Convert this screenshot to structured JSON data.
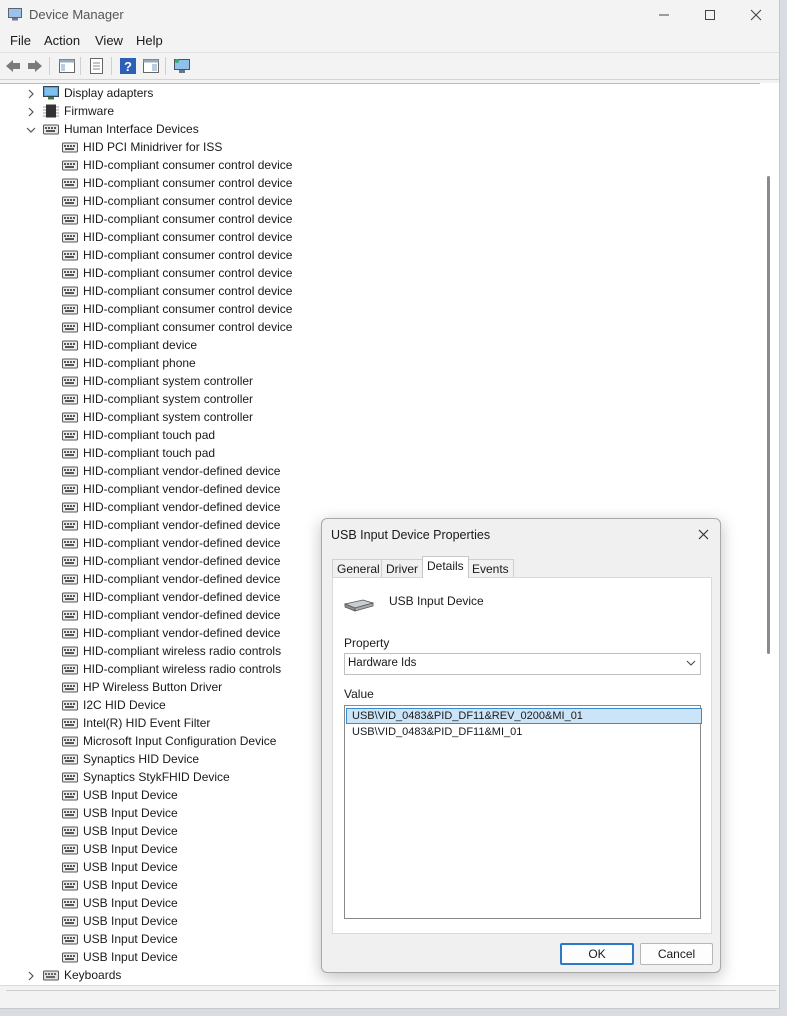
{
  "window": {
    "title": "Device Manager"
  },
  "menu": [
    "File",
    "Action",
    "View",
    "Help"
  ],
  "tree": {
    "categories_top": [
      {
        "label": "Display adapters",
        "expanded": false,
        "icon": "display-adapter-icon"
      },
      {
        "label": "Firmware",
        "expanded": false,
        "icon": "firmware-chip-icon"
      },
      {
        "label": "Human Interface Devices",
        "expanded": true,
        "icon": "hid-icon"
      }
    ],
    "hid_children": [
      "HID PCI Minidriver for ISS",
      "HID-compliant consumer control device",
      "HID-compliant consumer control device",
      "HID-compliant consumer control device",
      "HID-compliant consumer control device",
      "HID-compliant consumer control device",
      "HID-compliant consumer control device",
      "HID-compliant consumer control device",
      "HID-compliant consumer control device",
      "HID-compliant consumer control device",
      "HID-compliant consumer control device",
      "HID-compliant device",
      "HID-compliant phone",
      "HID-compliant system controller",
      "HID-compliant system controller",
      "HID-compliant system controller",
      "HID-compliant touch pad",
      "HID-compliant touch pad",
      "HID-compliant vendor-defined device",
      "HID-compliant vendor-defined device",
      "HID-compliant vendor-defined device",
      "HID-compliant vendor-defined device",
      "HID-compliant vendor-defined device",
      "HID-compliant vendor-defined device",
      "HID-compliant vendor-defined device",
      "HID-compliant vendor-defined device",
      "HID-compliant vendor-defined device",
      "HID-compliant vendor-defined device",
      "HID-compliant wireless radio controls",
      "HID-compliant wireless radio controls",
      "HP Wireless Button Driver",
      "I2C HID Device",
      "Intel(R) HID Event Filter",
      "Microsoft Input Configuration Device",
      "Synaptics HID Device",
      "Synaptics StykFHID Device",
      "USB Input Device",
      "USB Input Device",
      "USB Input Device",
      "USB Input Device",
      "USB Input Device",
      "USB Input Device",
      "USB Input Device",
      "USB Input Device",
      "USB Input Device",
      "USB Input Device"
    ],
    "categories_bottom": [
      {
        "label": "Keyboards",
        "expanded": false,
        "icon": "keyboard-icon"
      }
    ]
  },
  "dialog": {
    "title": "USB Input Device Properties",
    "tabs": [
      "General",
      "Driver",
      "Details",
      "Events"
    ],
    "active_tab": "Details",
    "device_name": "USB Input Device",
    "property_label": "Property",
    "property_value": "Hardware Ids",
    "value_label": "Value",
    "values": [
      "USB\\VID_0483&PID_DF11&REV_0200&MI_01",
      "USB\\VID_0483&PID_DF11&MI_01"
    ],
    "selected_value_index": 0,
    "ok_label": "OK",
    "cancel_label": "Cancel"
  },
  "colors": {
    "selection": "#cce4f7",
    "selection_border": "#3a8ad4",
    "primary_button_border": "#2b79c9"
  }
}
